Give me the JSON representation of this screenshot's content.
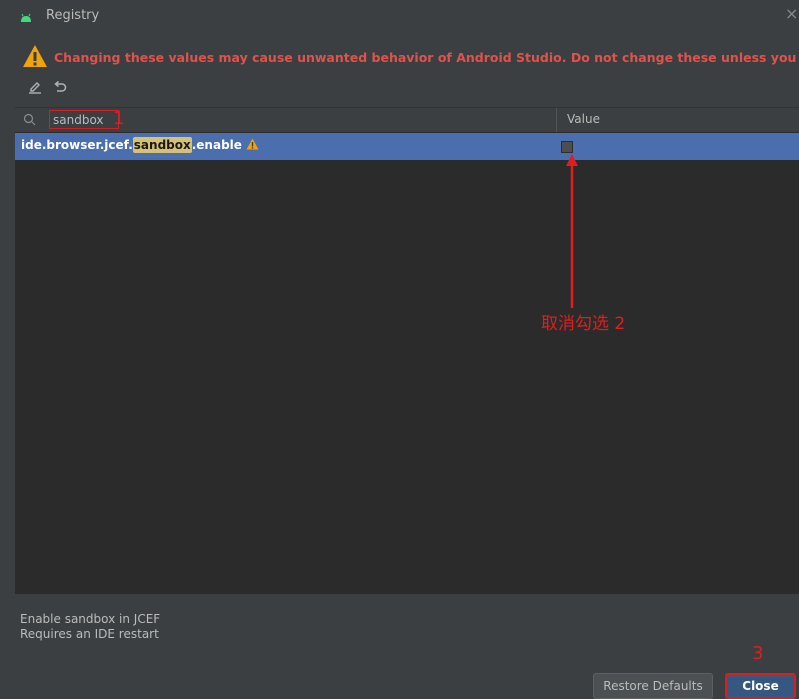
{
  "window": {
    "title": "Registry",
    "close_glyph": "×"
  },
  "warning": {
    "text": "Changing these values may cause unwanted behavior of Android Studio. Do not change these unless you have been asked to."
  },
  "toolbar": {
    "edit_icon": "edit-icon",
    "revert_icon": "revert-icon"
  },
  "table": {
    "search_value": "sandbox",
    "columns": [
      "",
      "Value"
    ],
    "rows": [
      {
        "key_prefix": "ide.browser.jcef.",
        "key_match": "sandbox",
        "key_suffix": ".enable",
        "has_warning": true,
        "value_checked": false
      }
    ]
  },
  "annotations": {
    "step1": "1",
    "step2": "取消勾选  2",
    "step3": "3",
    "color": "#e01e1e"
  },
  "description": {
    "line1": "Enable sandbox in JCEF",
    "line2": "Requires an IDE restart"
  },
  "buttons": {
    "restore_defaults": "Restore Defaults",
    "close": "Close"
  },
  "colors": {
    "background": "#3c3f41",
    "table_bg": "#2b2b2b",
    "selection": "#4b6eaf",
    "warning_text": "#e0524c",
    "match_highlight": "#d6c176",
    "primary_button": "#365880"
  }
}
